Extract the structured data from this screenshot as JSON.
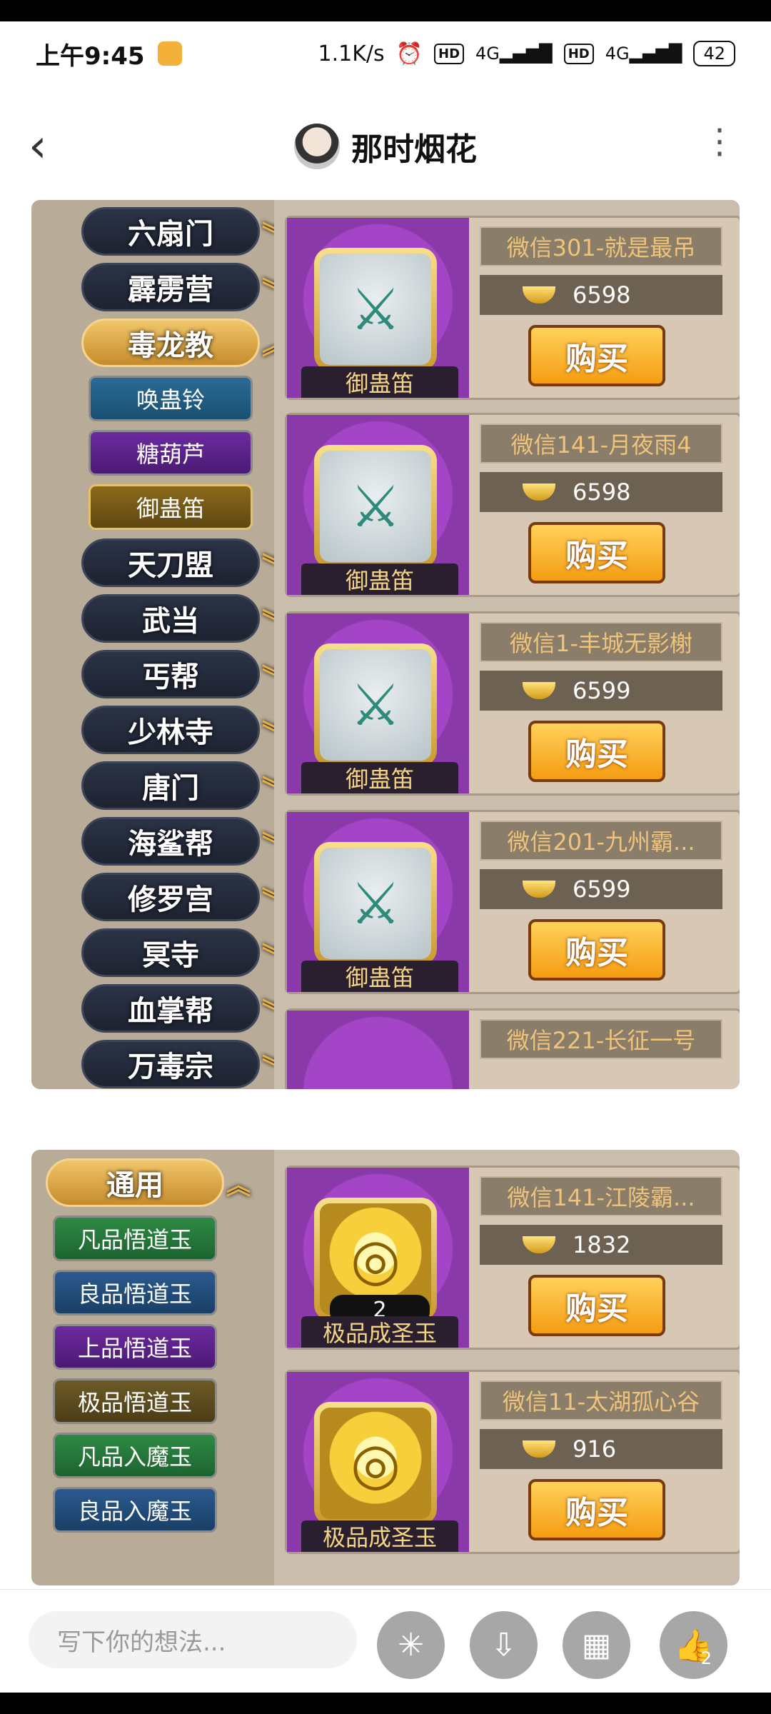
{
  "status": {
    "time": "上午9:45",
    "net_speed": "1.1K/s",
    "hd1": "HD",
    "net1": "4G",
    "hd2": "HD",
    "net2": "4G",
    "battery": "42"
  },
  "header": {
    "back": "‹",
    "title": "那时烟花",
    "more": "⋮"
  },
  "panel1": {
    "categories_top": [
      "六扇门",
      "霹雳营"
    ],
    "active_category": "毒龙教",
    "subitems": [
      "唤蛊铃",
      "糖葫芦",
      "御蛊笛"
    ],
    "categories_bottom": [
      "天刀盟",
      "武当",
      "丐帮",
      "少林寺",
      "唐门",
      "海鲨帮",
      "修罗宫",
      "冥寺",
      "血掌帮",
      "万毒宗"
    ],
    "chevron": "︾",
    "chevron_up": "︽",
    "listings": [
      {
        "seller": "微信301-就是最吊",
        "price": "6598",
        "item": "御蛊笛",
        "buy": "购买"
      },
      {
        "seller": "微信141-月夜雨4",
        "price": "6598",
        "item": "御蛊笛",
        "buy": "购买"
      },
      {
        "seller": "微信1-丰城无影榭",
        "price": "6599",
        "item": "御蛊笛",
        "buy": "购买"
      },
      {
        "seller": "微信201-九州霸...",
        "price": "6599",
        "item": "御蛊笛",
        "buy": "购买"
      },
      {
        "seller": "微信221-长征一号",
        "price": "",
        "item": "",
        "buy": ""
      }
    ]
  },
  "panel2": {
    "active_category": "通用",
    "subitems": [
      "凡品悟道玉",
      "良品悟道玉",
      "上品悟道玉",
      "极品悟道玉",
      "凡品入魔玉",
      "良品入魔玉"
    ],
    "listings": [
      {
        "seller": "微信141-江陵霸...",
        "price": "1832",
        "item": "极品成圣玉",
        "qty": "2",
        "buy": "购买"
      },
      {
        "seller": "微信11-太湖孤心谷",
        "price": "916",
        "item": "极品成圣玉",
        "qty": "",
        "buy": "购买"
      }
    ]
  },
  "bottom": {
    "placeholder": "写下你的想法...",
    "like_count": "2"
  },
  "icons": {
    "flute": "⚔",
    "jade": "◎",
    "share": "✳",
    "download": "⇩",
    "grid": "▦",
    "like": "👍"
  }
}
